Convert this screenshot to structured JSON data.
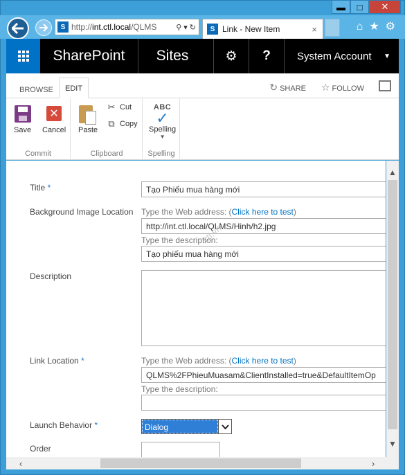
{
  "browser": {
    "address_prefix": "http://",
    "address_host": "int.ctl.local",
    "address_path": "/QLMS",
    "tab_title": "Link - New Item",
    "tab_close": "×"
  },
  "window_controls": {
    "minimize": "▬",
    "maximize": "□",
    "close": "✕"
  },
  "suite_bar": {
    "brand": "SharePoint",
    "sites": "Sites",
    "settings_icon": "⚙",
    "help_icon": "?",
    "account": "System Account"
  },
  "ribbon": {
    "tabs": [
      {
        "label": "BROWSE"
      },
      {
        "label": "EDIT"
      }
    ],
    "share": "SHARE",
    "follow": "FOLLOW",
    "groups": {
      "commit": {
        "label": "Commit",
        "save": "Save",
        "cancel": "Cancel"
      },
      "clipboard": {
        "label": "Clipboard",
        "paste": "Paste",
        "cut": "Cut",
        "copy": "Copy"
      },
      "spelling": {
        "label": "Spelling",
        "abc": "ABC",
        "spelling_btn": "Spelling"
      }
    }
  },
  "form": {
    "title_label": "Title",
    "title_value": "Tạo Phiếu mua hàng mới",
    "bg_label": "Background Image Location",
    "bg_hint_prefix": "Type the Web address: (",
    "bg_hint_link": "Click here to test",
    "bg_hint_suffix": ")",
    "bg_url_value": "http://int.ctl.local/QLMS/Hinh/h2.jpg",
    "bg_desc_hint": "Type the description:",
    "bg_desc_value": "Tạo phiếu mua hàng mới",
    "description_label": "Description",
    "link_label": "Link Location",
    "link_hint_prefix": "Type the Web address: (",
    "link_hint_link": "Click here to test",
    "link_hint_suffix": ")",
    "link_url_value": "QLMS%2FPhieuMuasam&ClientInstalled=true&DefaultItemOp",
    "link_desc_hint": "Type the description:",
    "link_desc_value": "",
    "launch_label": "Launch Behavior",
    "launch_value": "Dialog",
    "order_label": "Order",
    "required_mark": "*",
    "watermark": "ctl.vn"
  }
}
